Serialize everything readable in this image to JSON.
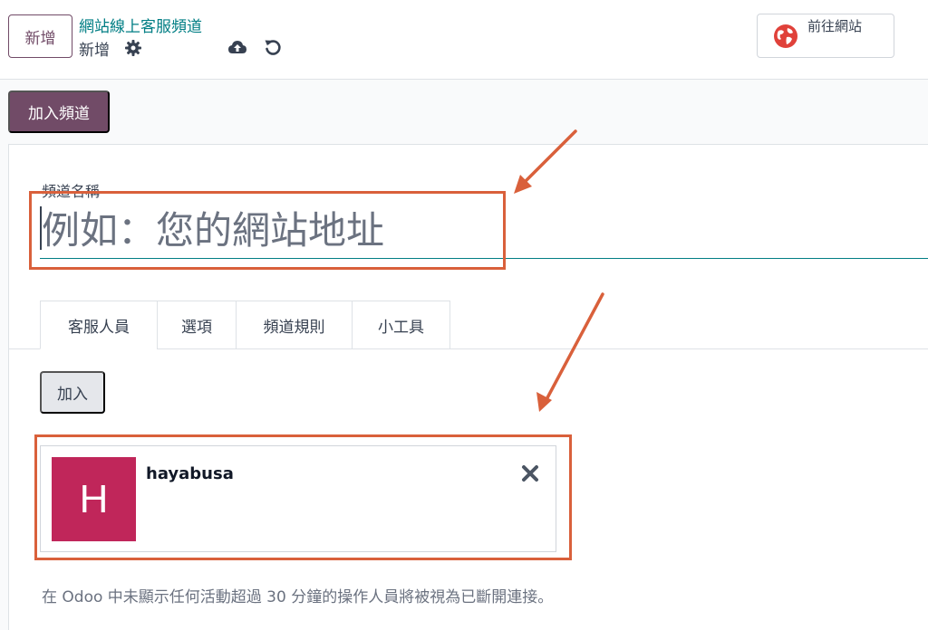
{
  "control_panel": {
    "new_button": "新增",
    "breadcrumb_parent": "網站線上客服頻道",
    "breadcrumb_current": "新增",
    "icons": [
      "gear-icon",
      "cloud-upload-icon",
      "undo-icon"
    ],
    "website_button": "前往網站",
    "website_icon": "globe-icon"
  },
  "actions": {
    "join_button": "加入頻道"
  },
  "form": {
    "channel_name_label": "頻道名稱",
    "channel_name_placeholder": "例如：您的網站地址",
    "channel_name_value": ""
  },
  "tabs": [
    {
      "label": "客服人員",
      "active": true
    },
    {
      "label": "選項",
      "active": false
    },
    {
      "label": "頻道規則",
      "active": false
    },
    {
      "label": "小工具",
      "active": false
    }
  ],
  "agents_tab": {
    "add_button": "加入",
    "agents": [
      {
        "initial": "H",
        "name": "hayabusa",
        "avatar_color": "#c0265a",
        "remove_icon": "close-icon"
      }
    ],
    "note": "在 Odoo 中未顯示任何活動超過 30 分鐘的操作人員將被視為已斷開連接。"
  },
  "colors": {
    "brand": "#714b67",
    "link": "#017e84",
    "annotation": "#d9603b"
  }
}
